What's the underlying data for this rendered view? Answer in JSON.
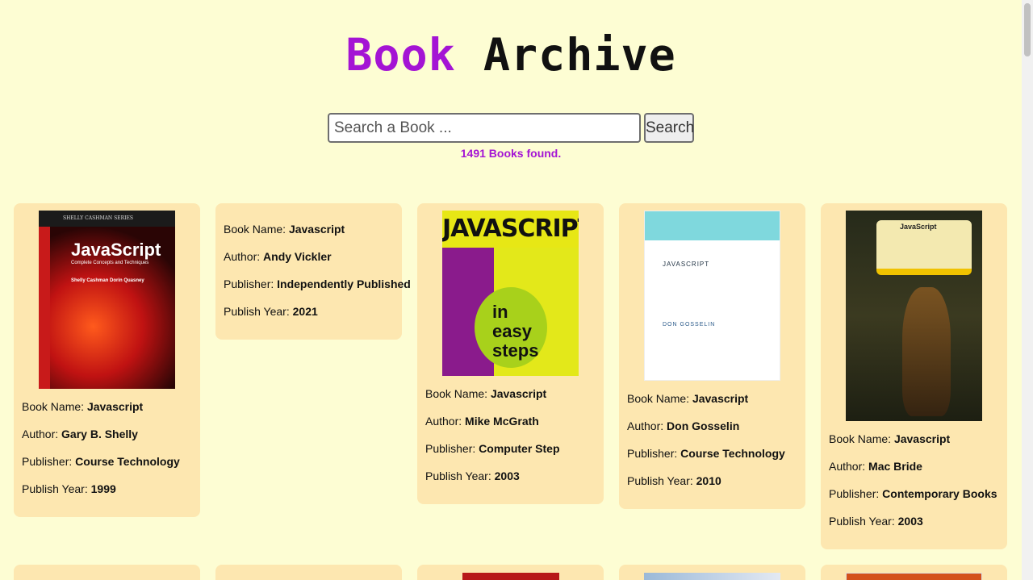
{
  "header": {
    "title_part1": "Book",
    "title_part2": "Archive"
  },
  "search": {
    "placeholder": "Search a Book ...",
    "button_label": "Search",
    "result_text": "1491 Books found."
  },
  "labels": {
    "name": "Book Name: ",
    "author": "Author: ",
    "publisher": "Publisher: ",
    "year": "Publish Year: "
  },
  "books": [
    {
      "name": "Javascript",
      "author": "Gary B. Shelly",
      "publisher": "Course Technology",
      "year": "1999",
      "cover": {
        "series": "SHELLY CASHMAN SERIES",
        "title": "JavaScript",
        "subtitle": "Complete Concepts and Techniques",
        "authors": "Shelly Cashman Dorin Quasney"
      }
    },
    {
      "name": "Javascript",
      "author": "Andy Vickler",
      "publisher": "Independently Published",
      "year": "2021"
    },
    {
      "name": "Javascript",
      "author": "Mike McGrath",
      "publisher": "Computer Step",
      "year": "2003",
      "cover": {
        "title": "JAVASCRIPT",
        "sub1": "in",
        "sub2": "easy steps"
      }
    },
    {
      "name": "Javascript",
      "author": "Don Gosselin",
      "publisher": "Course Technology",
      "year": "2010",
      "cover": {
        "title": "JAVASCRIPT",
        "author": "DON GOSSELIN"
      }
    },
    {
      "name": "Javascript",
      "author": "Mac Bride",
      "publisher": "Contemporary Books",
      "year": "2003",
      "cover": {
        "title": "JavaScript"
      }
    }
  ],
  "colors": {
    "background": "#fdfdd3",
    "card": "#fde7b0",
    "accent": "#a414d4"
  }
}
